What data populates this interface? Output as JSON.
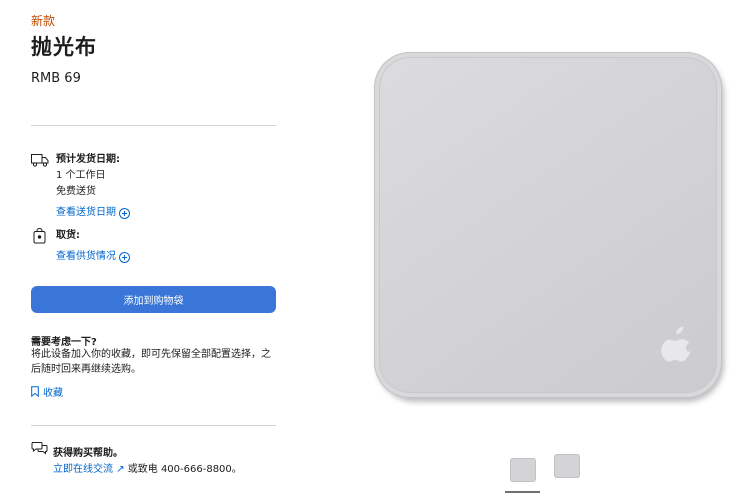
{
  "product": {
    "badge": "新款",
    "title": "抛光布",
    "price": "RMB 69"
  },
  "delivery": {
    "icon": "truck-icon",
    "title": "预计发货日期:",
    "line1": "1 个工作日",
    "line2": "免费送货",
    "link": "查看送货日期"
  },
  "pickup": {
    "icon": "store-bag-icon",
    "title": "取货:",
    "link": "查看供货情况"
  },
  "add_to_bag_label": "添加到购物袋",
  "consider": {
    "title": "需要考虑一下?",
    "text": "将此设备加入你的收藏，即可先保留全部配置选择，之后随时回来再继续选购。",
    "save_label": "收藏"
  },
  "help": {
    "icon": "chat-bubbles-icon",
    "title": "获得购买帮助。",
    "chat_link": "立即在线交流",
    "phone_text": "或致电 400-666-8800。"
  },
  "colors": {
    "accent": "#06c",
    "button": "#3a76d8",
    "badge": "#bf4800"
  },
  "gallery": {
    "thumbnail_count": 2,
    "selected": 1
  }
}
